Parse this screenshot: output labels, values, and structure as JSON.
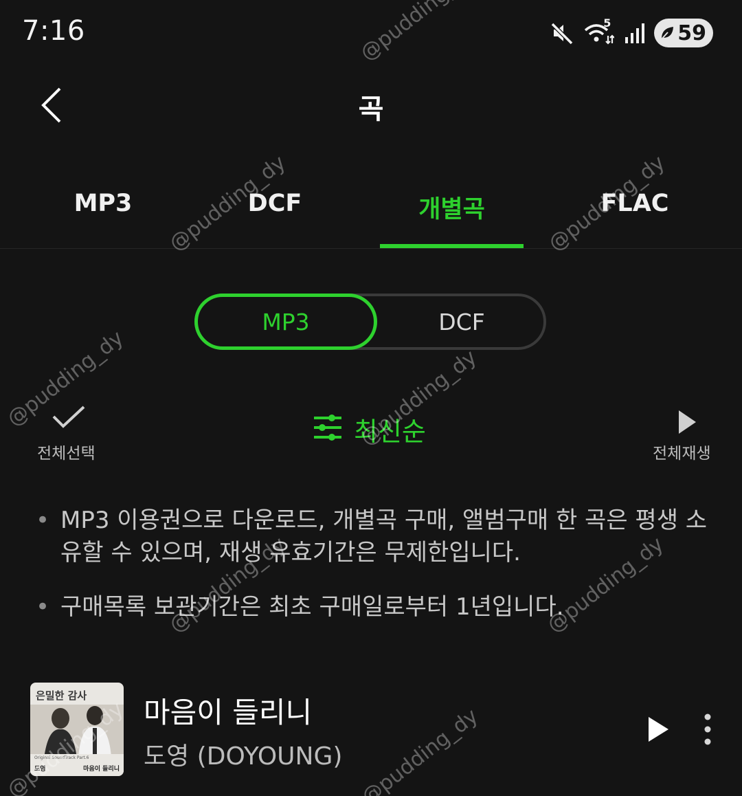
{
  "status_bar": {
    "time": "7:16",
    "battery": "59",
    "network": "5"
  },
  "header": {
    "title": "곡"
  },
  "format_tabs": [
    "MP3",
    "DCF",
    "개별곡",
    "FLAC"
  ],
  "sub_toggle": {
    "options": [
      "MP3",
      "DCF"
    ],
    "selected": "MP3"
  },
  "toolbar": {
    "select_all": "전체선택",
    "sort": "최신순",
    "play_all": "전체재생"
  },
  "notices": [
    "MP3 이용권으로 다운로드, 개별곡 구매, 앨범구매 한 곡은 평생 소유할 수 있으며, 재생 유효기간은 무제한입니다.",
    "구매목록 보관기간은 최초 구매일로부터 1년입니다."
  ],
  "songs": [
    {
      "title": "마음이 들리니",
      "artist": "도영 (DOYOUNG)"
    }
  ],
  "album_art": {
    "title": "은밀한 감사",
    "subtitle": "Original SoundTrack Part.6",
    "artist": "도영",
    "song": "마음이 들리니"
  },
  "watermark": "@pudding_dy",
  "colors": {
    "accent": "#2ed12e",
    "background": "#141414"
  }
}
